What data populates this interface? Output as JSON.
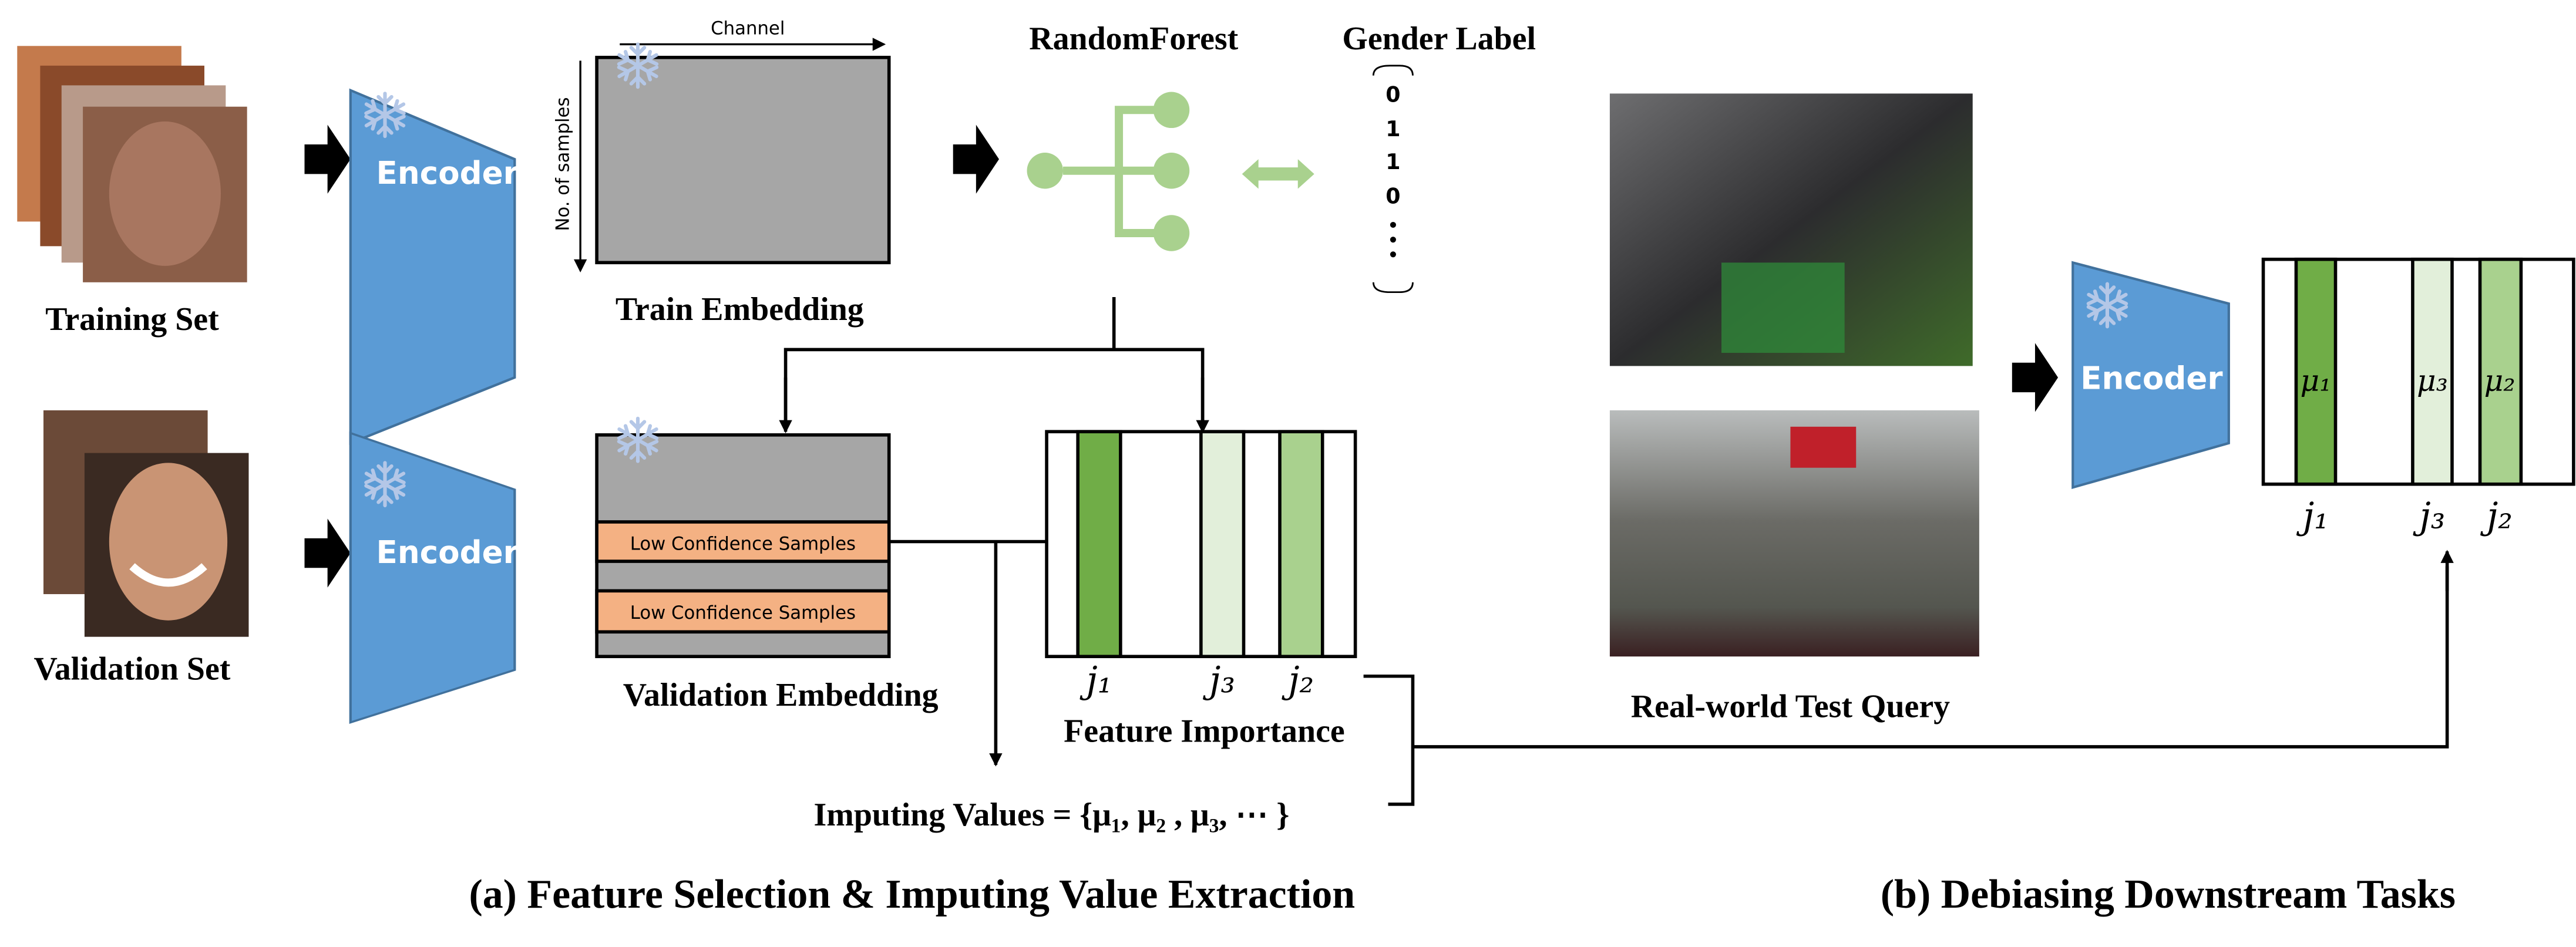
{
  "panel_a": {
    "training_set_label": "Training Set",
    "validation_set_label": "Validation Set",
    "encoder_label": "Encoder",
    "channel_axis_label": "Channel",
    "samples_axis_label": "No. of samples",
    "train_embedding_label": "Train Embedding",
    "random_forest_label": "RandomForest",
    "gender_label_title": "Gender Label",
    "gender_label_values": [
      "0",
      "1",
      "1",
      "0"
    ],
    "low_confidence_label": "Low Confidence Samples",
    "validation_embedding_label": "Validation Embedding",
    "feature_labels": [
      "j₁",
      "j₃",
      "j₂"
    ],
    "feature_importance_label": "Feature Importance",
    "imputing_values_label": "Imputing Values = {μ₁, μ₂ , μ₃, ⋯ }",
    "caption": "(a) Feature Selection & Imputing Value Extraction"
  },
  "panel_b": {
    "test_query_label": "Real-world Test Query",
    "encoder_label": "Encoder",
    "imputed_labels": [
      "μ₁",
      "μ₃",
      "μ₂"
    ],
    "feature_labels": [
      "j₁",
      "j₃",
      "j₂"
    ],
    "caption": "(b) Debiasing Downstream Tasks"
  },
  "colors": {
    "encoder": "#5b9bd5",
    "embedding": "#a6a6a6",
    "low_confidence": "#f4b183",
    "feature_dark": "#70ad47",
    "feature_mid": "#a9d18e",
    "feature_light": "#e2efda",
    "random_forest": "#a9d18e",
    "snowflake": "#b4c7e7"
  }
}
